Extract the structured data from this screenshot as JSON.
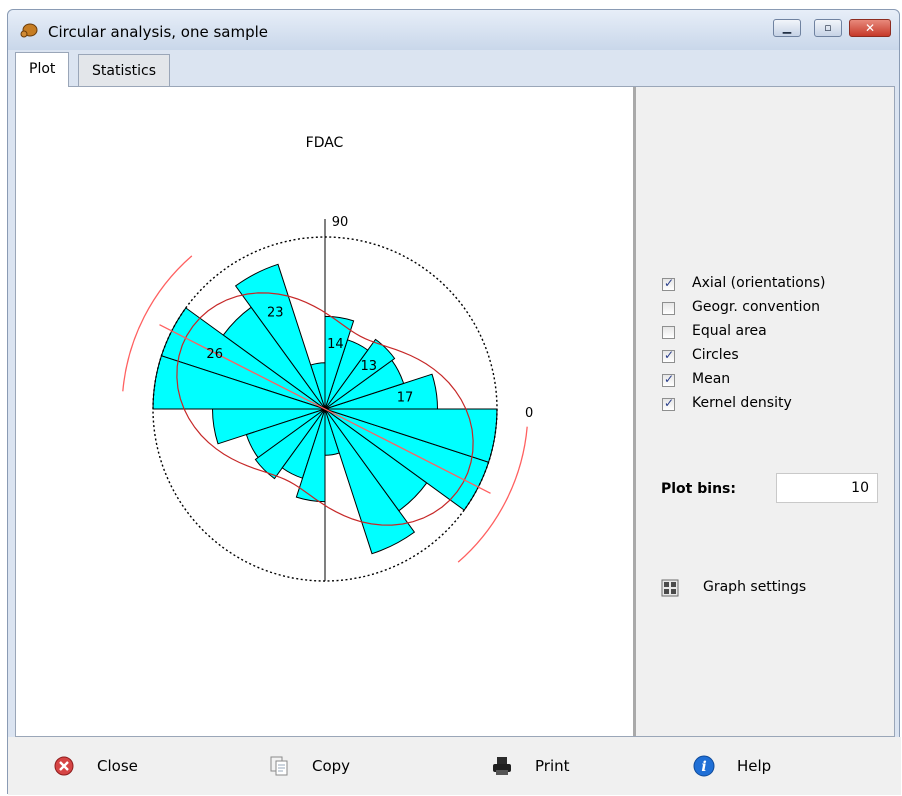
{
  "window": {
    "title": "Circular analysis, one sample"
  },
  "tabs": [
    {
      "label": "Plot"
    },
    {
      "label": "Statistics"
    }
  ],
  "chart_data": {
    "type": "rose",
    "title": "FDAC",
    "axis_labels": {
      "top": "90",
      "right": "0"
    },
    "bin_width_deg": 18,
    "max_count": 26,
    "bins": [
      {
        "start_deg": 0,
        "count": 17,
        "label": "17"
      },
      {
        "start_deg": 18,
        "count": 12.5,
        "label": ""
      },
      {
        "start_deg": 36,
        "count": 13,
        "label": "13"
      },
      {
        "start_deg": 54,
        "count": 11,
        "label": ""
      },
      {
        "start_deg": 72,
        "count": 14,
        "label": "14"
      },
      {
        "start_deg": 90,
        "count": 7,
        "label": ""
      },
      {
        "start_deg": 108,
        "count": 23,
        "label": "23"
      },
      {
        "start_deg": 126,
        "count": 19,
        "label": ""
      },
      {
        "start_deg": 144,
        "count": 26,
        "label": "26"
      },
      {
        "start_deg": 162,
        "count": 26,
        "label": ""
      },
      {
        "start_deg": 180,
        "count": 17,
        "label": ""
      },
      {
        "start_deg": 198,
        "count": 12.5,
        "label": ""
      },
      {
        "start_deg": 216,
        "count": 13,
        "label": ""
      },
      {
        "start_deg": 234,
        "count": 11,
        "label": ""
      },
      {
        "start_deg": 252,
        "count": 14,
        "label": ""
      },
      {
        "start_deg": 270,
        "count": 7,
        "label": ""
      },
      {
        "start_deg": 288,
        "count": 23,
        "label": ""
      },
      {
        "start_deg": 306,
        "count": 19,
        "label": ""
      },
      {
        "start_deg": 324,
        "count": 26,
        "label": ""
      },
      {
        "start_deg": 342,
        "count": 26,
        "label": ""
      }
    ],
    "mean_direction_deg": 153,
    "confidence_halfwidth_deg": 22,
    "colors": {
      "bars": "#00ffff",
      "bar_outline": "#000000",
      "mean": "#ff6060",
      "kernel": "#c62828",
      "circle": "#000000"
    }
  },
  "options": [
    {
      "label": "Axial (orientations)",
      "checked": true
    },
    {
      "label": "Geogr. convention",
      "checked": false
    },
    {
      "label": "Equal area",
      "checked": false
    },
    {
      "label": "Circles",
      "checked": true
    },
    {
      "label": "Mean",
      "checked": true
    },
    {
      "label": "Kernel density",
      "checked": true
    }
  ],
  "plot_bins": {
    "label": "Plot bins:",
    "value": "10"
  },
  "graph_settings": {
    "label": "Graph settings",
    "icon": "grid-icon"
  },
  "buttons": [
    {
      "label": "Close",
      "icon": "close-circle-icon"
    },
    {
      "label": "Copy",
      "icon": "copy-icon"
    },
    {
      "label": "Print",
      "icon": "printer-icon"
    },
    {
      "label": "Help",
      "icon": "info-icon"
    }
  ]
}
